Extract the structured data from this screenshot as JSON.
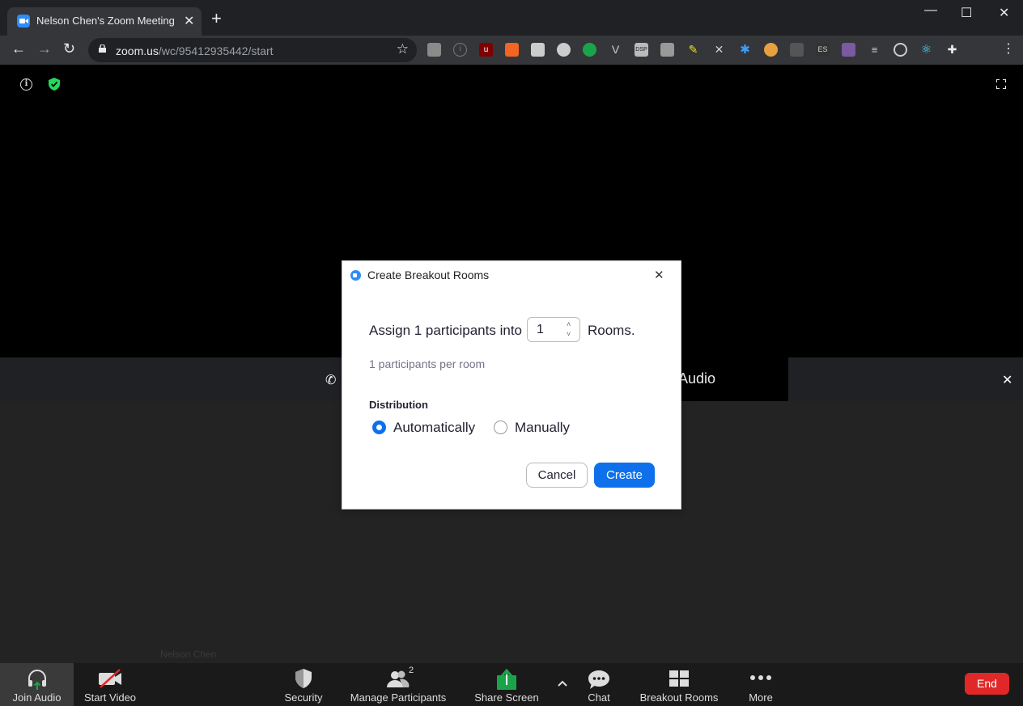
{
  "browser": {
    "tab_title": "Nelson Chen's Zoom Meeting",
    "url_host": "zoom.us",
    "url_path": "/wc/95412935442/start"
  },
  "meeting": {
    "audio_banner_text": "Audio",
    "participant_name": "Nelson Chen"
  },
  "controls": {
    "join_audio": "Join Audio",
    "start_video": "Start Video",
    "security": "Security",
    "manage_participants": "Manage Participants",
    "participant_count": "2",
    "share_screen": "Share Screen",
    "chat": "Chat",
    "breakout_rooms": "Breakout Rooms",
    "more": "More",
    "end": "End"
  },
  "dialog": {
    "title": "Create Breakout Rooms",
    "assign_prefix": "Assign 1 participants into",
    "room_count": "1",
    "assign_suffix": "Rooms.",
    "per_room": "1 participants per room",
    "distribution_label": "Distribution",
    "option_auto": "Automatically",
    "option_manual": "Manually",
    "selected": "Automatically",
    "cancel": "Cancel",
    "create": "Create"
  },
  "colors": {
    "accent": "#0e71eb",
    "end": "#e02828",
    "share_green": "#1aa44a"
  }
}
